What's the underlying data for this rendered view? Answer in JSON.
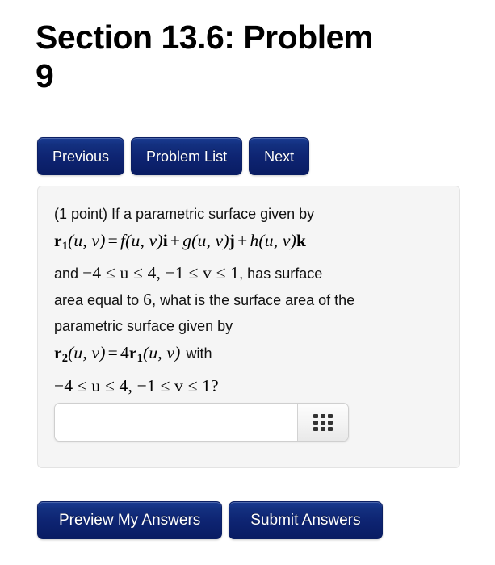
{
  "page": {
    "title": "Section 13.6: Problem 9"
  },
  "nav_buttons": [
    {
      "label": "Previous",
      "name": "previous-button"
    },
    {
      "label": "Problem List",
      "name": "problem-list-button"
    },
    {
      "label": "Next",
      "name": "next-button"
    }
  ],
  "problem": {
    "points_text": "(1 point) If a parametric surface given by",
    "line2_plain": "",
    "math1": {
      "r_bold": "r",
      "r_sub": "1",
      "args": "(u, v)",
      "equals": "=",
      "f": "f",
      "f_args": "(u, v)",
      "i": "i",
      "plus1": "+",
      "g": "g",
      "g_args": "(u, v)",
      "j": "j",
      "plus2": "+",
      "h": "h",
      "h_args": "(u, v)",
      "k": "k"
    },
    "line3_prefix": "and",
    "math2": "−4 ≤ u ≤ 4, −1 ≤ v ≤ 1",
    "line3_suffix": ", has surface",
    "line4_prefix": "area equal to",
    "math3": "6",
    "line4_suffix": ", what is the surface area of the",
    "line5": "parametric surface given by",
    "math4": {
      "r2_bold": "r",
      "r2_sub": "2",
      "args": "(u, v)",
      "equals": "=",
      "coef": "4",
      "r1_bold": "r",
      "r1_sub": "1",
      "args2": "(u, v)"
    },
    "line6_suffix": "with",
    "math5": "−4 ≤ u ≤ 4, −1 ≤ v ≤ 1?"
  },
  "answer": {
    "value": "",
    "placeholder": "",
    "keypad_icon": "grid-keypad-icon"
  },
  "footer_buttons": [
    {
      "label": "Preview My Answers",
      "name": "preview-my-answers-button"
    },
    {
      "label": "Submit Answers",
      "name": "submit-answers-button"
    }
  ],
  "colors": {
    "button_blue_top": "#1b3c93",
    "button_blue_bottom": "#091c63",
    "panel_bg": "#f5f5f5",
    "panel_border": "#e3e3e3",
    "text": "#111111"
  }
}
